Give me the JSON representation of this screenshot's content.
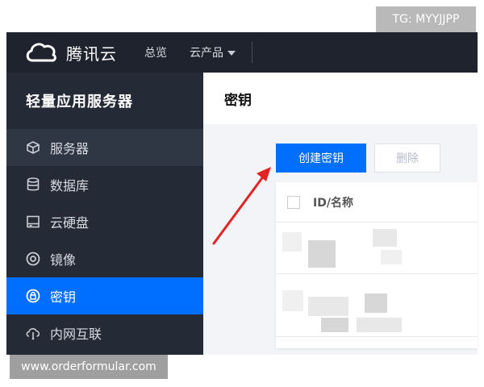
{
  "watermark_top": "TG: MYYJJPP",
  "watermark_bottom": "www.orderformular.com",
  "topbar": {
    "brand_name": "腾讯云",
    "nav": [
      "总览",
      "云产品"
    ]
  },
  "sidebar": {
    "title": "轻量应用服务器",
    "items": [
      {
        "label": "服务器",
        "icon": "cube-icon"
      },
      {
        "label": "数据库",
        "icon": "database-icon"
      },
      {
        "label": "云硬盘",
        "icon": "disk-icon"
      },
      {
        "label": "镜像",
        "icon": "image-disc-icon"
      },
      {
        "label": "密钥",
        "icon": "key-lock-icon",
        "active": true
      },
      {
        "label": "内网互联",
        "icon": "network-icon"
      }
    ]
  },
  "main": {
    "title": "密钥",
    "create_button": "创建密钥",
    "delete_button": "删除",
    "table": {
      "header": "ID/名称"
    }
  },
  "colors": {
    "topbar_bg": "#1f232d",
    "sidebar_bg": "#242a36",
    "active_item": "#006eff",
    "arrow": "#e02424"
  }
}
